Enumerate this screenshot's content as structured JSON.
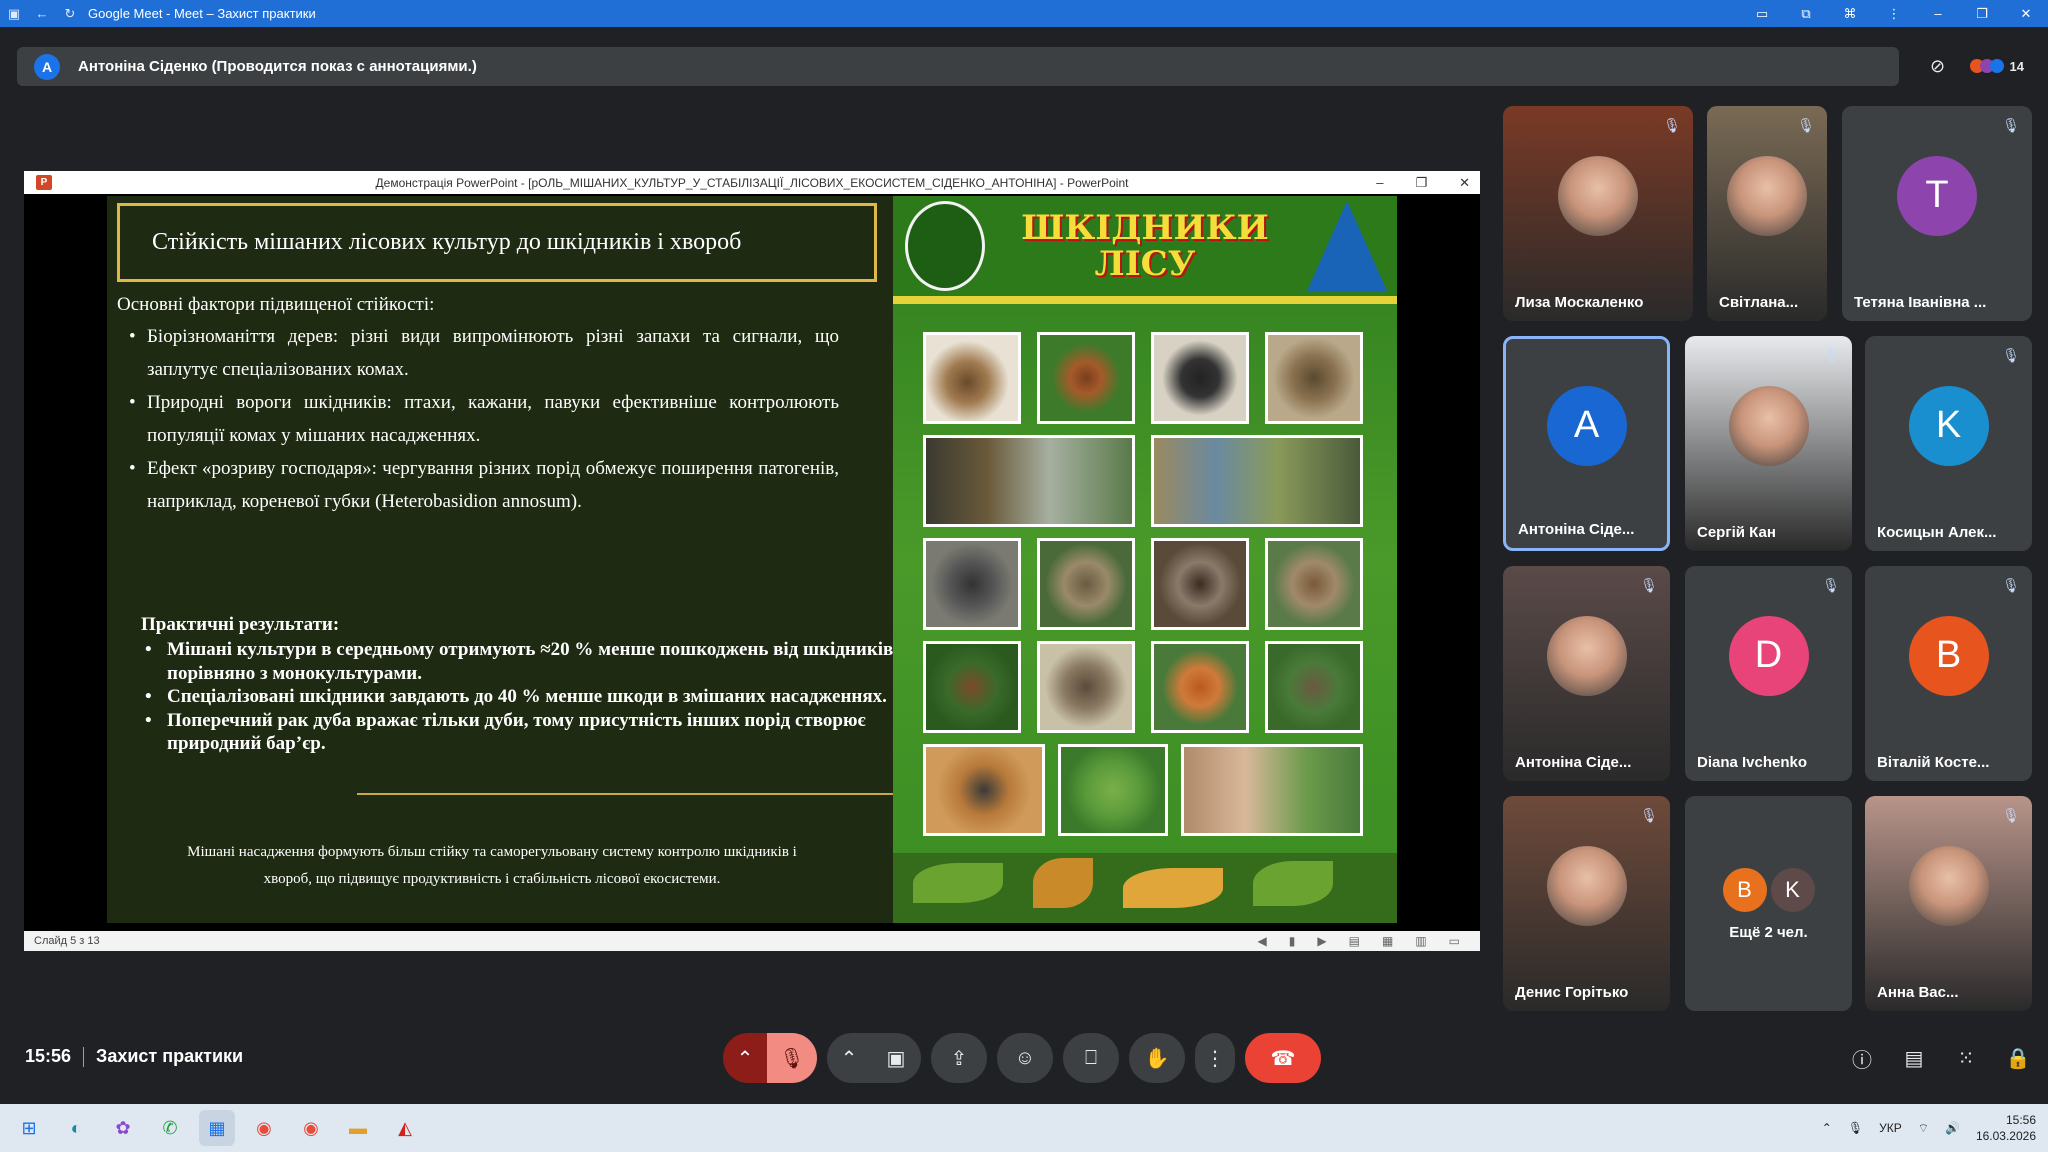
{
  "browser": {
    "title": "Google Meet - Meet – Захист практики",
    "controls": {
      "minimize": "–",
      "maximize": "❐",
      "close": "✕"
    }
  },
  "presenter_bar": {
    "avatar_letter": "A",
    "text": "Антоніна Сіденко (Проводится показ с аннотациями.)",
    "participant_count": "14"
  },
  "powerpoint": {
    "window_title": "Демонстрація PowerPoint - [рОЛЬ_МІШАНИХ_КУЛЬТУР_У_СТАБІЛІЗАЦІЇ_ЛІСОВИХ_ЕКОСИСТЕМ_СІДЕНКО_АНТОНІНА] - PowerPoint",
    "status": "Слайд 5 з 13",
    "slide": {
      "title": "Стійкість мішаних лісових культур до шкідників і хвороб",
      "subtitle": "Основні фактори підвищеної стійкості:",
      "bullets": [
        "Біорізноманіття дерев: різні види випромінюють різні запахи та сигнали, що заплутує спеціалізованих комах.",
        "Природні вороги шкідників: птахи, кажани, павуки ефективніше контролюють популяції комах у мішаних насадженнях.",
        "Ефект «розриву господаря»: чергування різних порід обмежує поширення патогенів, наприклад, кореневої губки (Heterobasidion annosum)."
      ],
      "results_heading": "Практичні результати:",
      "results": [
        "Мішані культури в середньому отримують ≈20 % менше пошкоджень від шкідників порівняно з монокультурами.",
        "Спеціалізовані шкідники завдають до 40 % менше шкоди в змішаних насадженнях.",
        "Поперечний рак дуба вражає тільки дуби, тому присутність інших порід створює природний бар’єр."
      ],
      "footer": "Мішані насадження формують більш стійку та саморегульовану систему контролю шкідників і хвороб, що підвищує продуктивність і стабільність лісової екосистеми.",
      "poster_title_1": "ШКІДНИКИ",
      "poster_title_2": "ЛІСУ"
    }
  },
  "participants": [
    {
      "name": "Лиза Москаленко",
      "letter": "",
      "color": "#7a3a26"
    },
    {
      "name": "Світлана...",
      "letter": "",
      "color": "#7a6a55"
    },
    {
      "name": "Тетяна Іванівна ...",
      "letter": "T",
      "color": "#8e44ad"
    },
    {
      "name": "Антоніна Сіде...",
      "letter": "A",
      "color": "#1967d2"
    },
    {
      "name": "Сергій Кан",
      "letter": "",
      "color": "#e8eaed"
    },
    {
      "name": "Косицын Алек...",
      "letter": "K",
      "color": "#1a8fd0"
    },
    {
      "name": "Антоніна Сіде...",
      "letter": "",
      "color": "#5a4a48"
    },
    {
      "name": "Diana Ivchenko",
      "letter": "D",
      "color": "#e8447a"
    },
    {
      "name": "Віталій Косте...",
      "letter": "B",
      "color": "#e8541e"
    },
    {
      "name": "Денис Горітько",
      "letter": "",
      "color": "#6e4a3a"
    },
    {
      "name": "Ещё 2 чел.",
      "letter": "",
      "color": "#3c4043"
    },
    {
      "name": "Анна Вас...",
      "letter": "",
      "color": "#b8948a"
    }
  ],
  "more_avatars": [
    "B",
    "K"
  ],
  "meeting": {
    "time": "15:56",
    "name": "Захист практики"
  },
  "taskbar": {
    "lang": "УКР",
    "time": "15:56",
    "date": "16.03.2026"
  },
  "colors": {
    "accent": "#1a73e8",
    "end_call": "#ea4335",
    "mic_off": "#f28b82"
  }
}
